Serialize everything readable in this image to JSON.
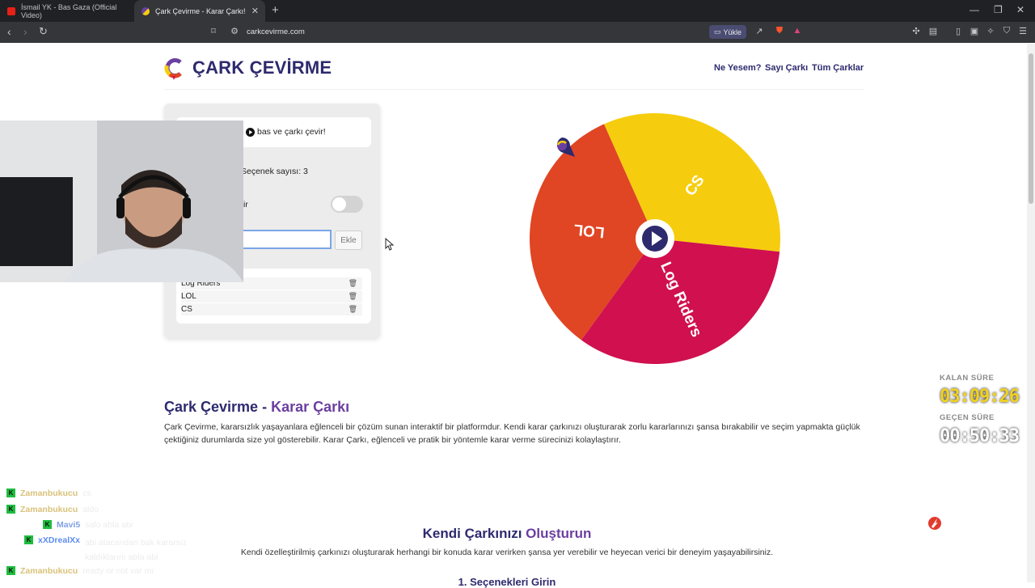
{
  "browser": {
    "tabs": [
      {
        "title": "İsmail YK - Bas Gaza (Official Video)"
      },
      {
        "title": "Çark Çevirme - Karar Çarkı!"
      }
    ],
    "url": "carkcevirme.com",
    "upload_label": "Yükle"
  },
  "site": {
    "logo_letter": "Ç",
    "logo_text": "ÇARK ÇEVİRME",
    "nav": [
      "Ne Yesem?",
      "Sayı Çarkı",
      "Tüm Çarklar"
    ]
  },
  "panel": {
    "hint": "bas ve çarkı çevir!",
    "option_count_label": "Seçenek sayısı: 3",
    "toggle_label_fragment": "ir",
    "add_button": "Ekle",
    "input_value": "",
    "options": [
      "Log Riders",
      "LOL",
      "CS"
    ]
  },
  "wheel": {
    "segments": [
      {
        "label": "CS",
        "color": "#f6cd0e"
      },
      {
        "label": "Log Riders",
        "color": "#d0104f"
      },
      {
        "label": "LOL",
        "color": "#e04524"
      }
    ],
    "center_color": "#2d2a6e"
  },
  "content": {
    "title_part1": "Çark Çevirme - ",
    "title_part2": "Karar Çarkı",
    "paragraph": "Çark Çevirme, kararsızlık yaşayanlara eğlenceli bir çözüm sunan interaktif bir platformdur. Kendi karar çarkınızı oluşturarak zorlu kararlarınızı şansa bırakabilir ve seçim yapmakta güçlük çektiğiniz durumlarda size yol gösterebilir. Karar Çarkı, eğlenceli ve pratik bir yöntemle karar verme sürecinizi kolaylaştırır.",
    "section_title_part1": "Kendi Çarkınızı ",
    "section_title_part2": "Oluşturun",
    "section_paragraph": "Kendi özelleştirilmiş çarkınızı oluşturarak herhangi bir konuda karar verirken şansa yer verebilir ve heyecan verici bir deneyim yaşayabilirsiniz.",
    "step_heading": "1. Seçenekleri Girin"
  },
  "stream_overlay": {
    "remaining_label": "KALAN SÜRE",
    "remaining_time": "03:09:26",
    "elapsed_label": "GEÇEN SÜRE",
    "elapsed_time": "00:50:33",
    "timer_color_remaining": "#f2d21f",
    "timer_color_elapsed": "#ffffff",
    "chat": [
      {
        "user": "Zamanbukucu",
        "message": "cs",
        "color": "#d9c27a"
      },
      {
        "user": "Zamanbukucu",
        "message": "aldo",
        "color": "#d9c27a"
      },
      {
        "user": "Mavi5",
        "message": "salo abla abi",
        "color": "#7f9fe6"
      },
      {
        "user": "xXDrealXx",
        "message": "abi atacandan bak kararsız kaldıklarını abla abi",
        "color": "#5c8df0"
      },
      {
        "user": "Zamanbukucu",
        "message": "ready or not var mı",
        "color": "#d9c27a"
      }
    ]
  }
}
